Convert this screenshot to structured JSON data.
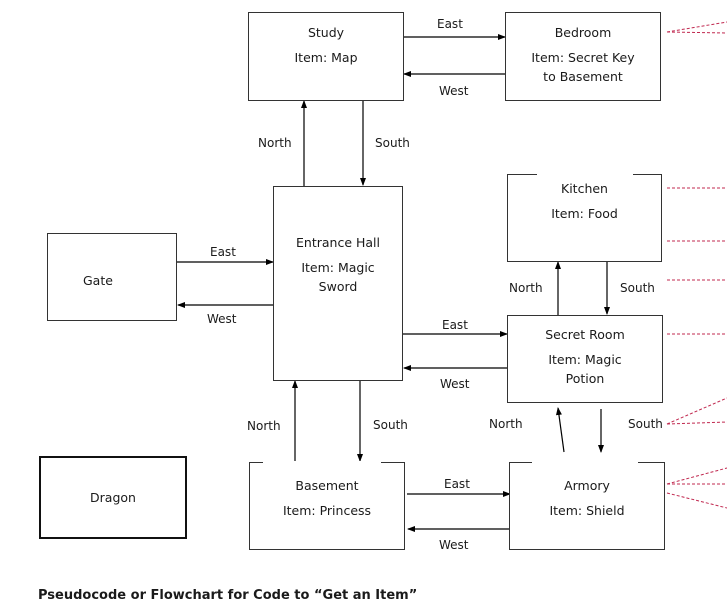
{
  "rooms": {
    "study": {
      "name": "Study",
      "item": "Item: Map"
    },
    "bedroom": {
      "name": "Bedroom",
      "item": "Item: Secret Key to Basement"
    },
    "entrance_hall": {
      "name": "Entrance Hall",
      "item": "Item: Magic Sword"
    },
    "gate": {
      "name": "Gate"
    },
    "kitchen": {
      "name": "Kitchen",
      "item": "Item: Food"
    },
    "secret_room": {
      "name": "Secret Room",
      "item": "Item: Magic Potion"
    },
    "basement": {
      "name": "Basement",
      "item": "Item: Princess"
    },
    "armory": {
      "name": "Armory",
      "item": "Item: Shield"
    },
    "dragon": {
      "name": "Dragon"
    }
  },
  "labels": {
    "study_bedroom_east": "East",
    "bedroom_study_west": "West",
    "entrance_study_north": "North",
    "study_entrance_south": "South",
    "gate_entrance_east": "East",
    "entrance_gate_west": "West",
    "entrance_secret_east": "East",
    "secret_entrance_west": "West",
    "secret_kitchen_north": "North",
    "kitchen_secret_south": "South",
    "basement_entrance_north": "North",
    "entrance_basement_south": "South",
    "armory_secret_north": "North",
    "secret_armory_south": "South",
    "basement_armory_east": "East",
    "armory_basement_west": "West"
  },
  "colors": {
    "line": "#000000",
    "box_border": "#333333",
    "comment_connector": "#c0284f"
  },
  "footer": {
    "text": "Pseudocode or Flowchart for Code to “Get an Item”"
  }
}
